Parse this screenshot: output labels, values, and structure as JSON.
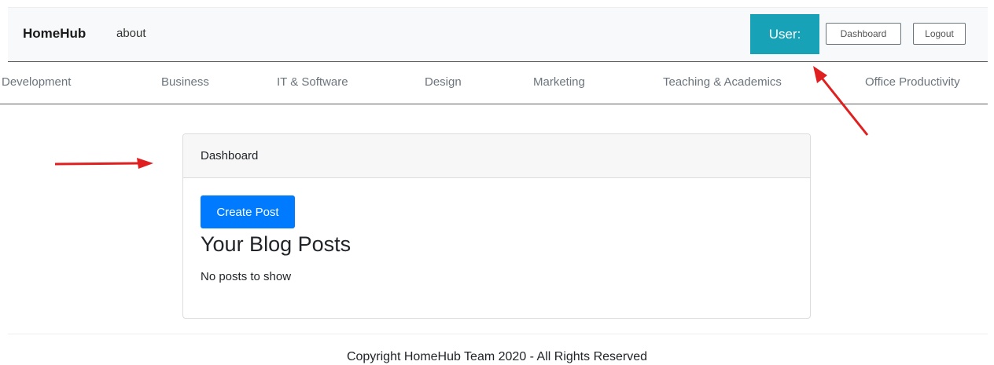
{
  "navbar": {
    "brand": "HomeHub",
    "about_label": "about",
    "user_label": "User:",
    "dashboard_label": "Dashboard",
    "logout_label": "Logout"
  },
  "categories": [
    "Development",
    "Business",
    "IT & Software",
    "Design",
    "Marketing",
    "Teaching & Academics",
    "Office Productivity"
  ],
  "card": {
    "header": "Dashboard",
    "create_post_label": "Create Post",
    "heading": "Your Blog Posts",
    "empty_message": "No posts to show"
  },
  "footer": {
    "text": "Copyright HomeHub Team 2020 - All Rights Reserved"
  },
  "colors": {
    "user_button": "#17a2b8",
    "primary_button": "#007bff",
    "annotation_arrow": "#e02020"
  }
}
